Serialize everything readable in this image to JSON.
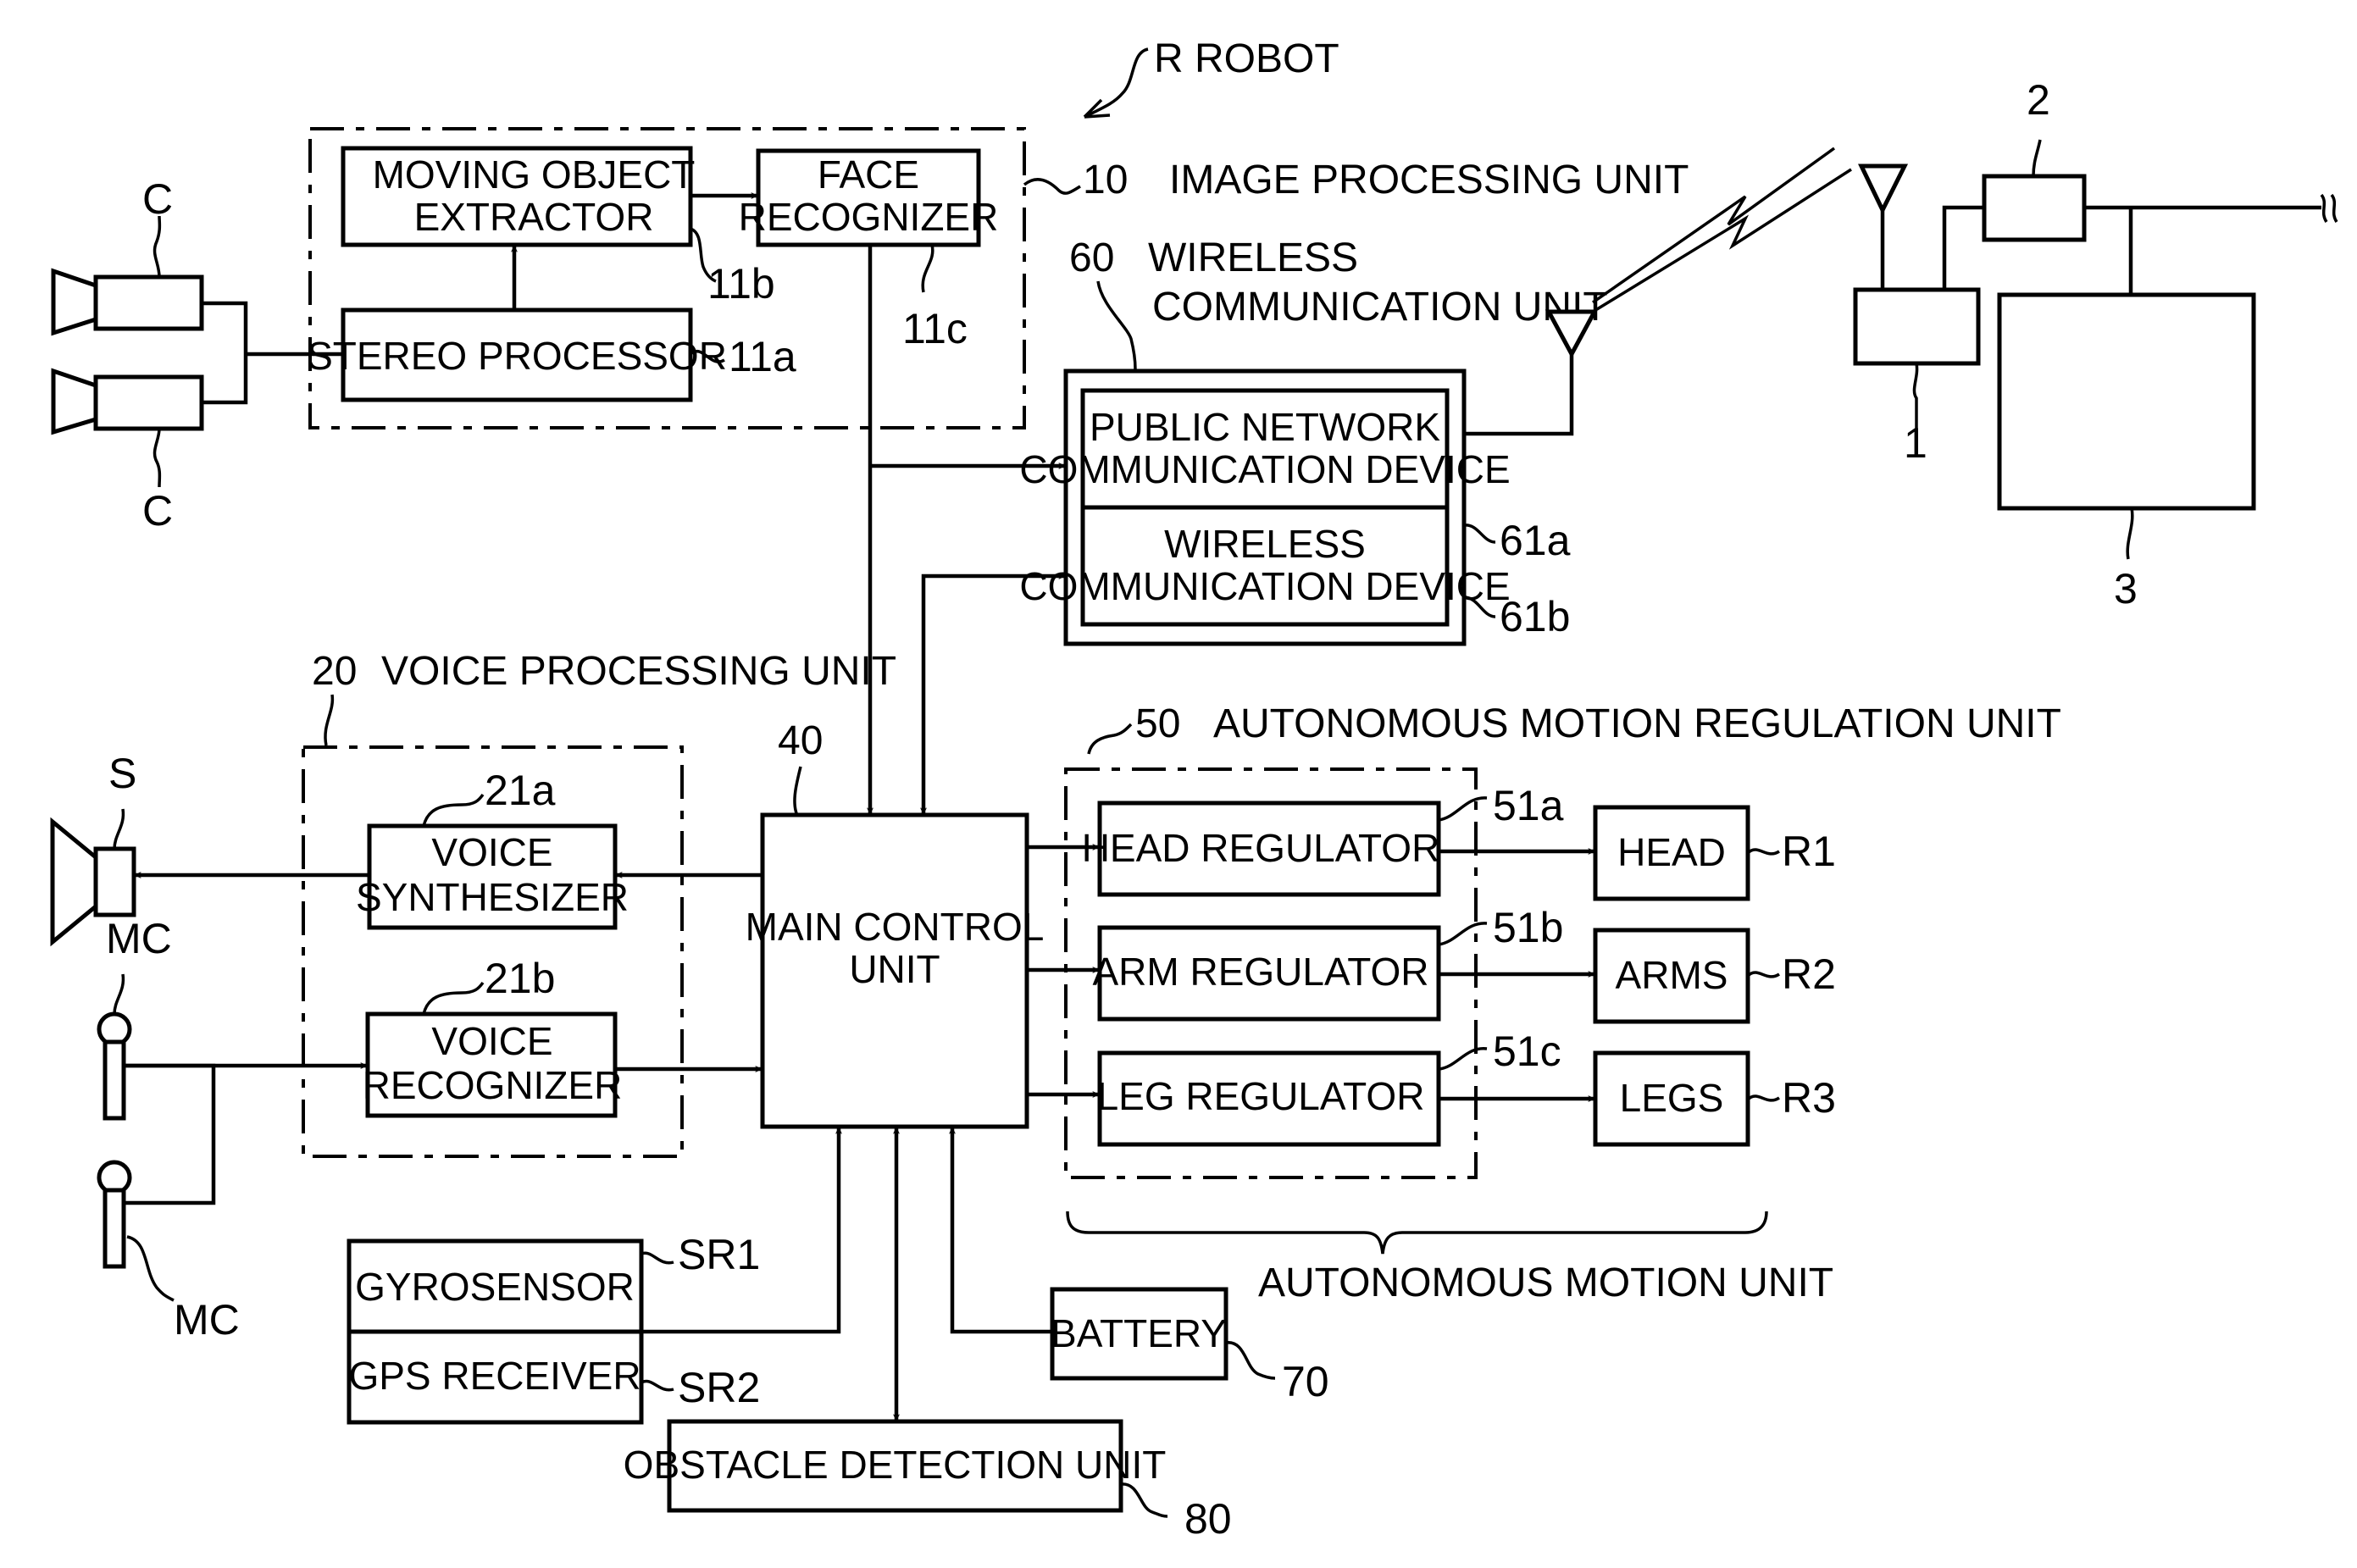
{
  "figure": {
    "robot_label": "R ROBOT",
    "units": {
      "image_processing": {
        "ref": "10",
        "title": "IMAGE PROCESSING UNIT"
      },
      "voice_processing": {
        "ref": "20",
        "title": "VOICE PROCESSING UNIT"
      },
      "main_control": {
        "ref": "40",
        "line1": "MAIN CONTROL",
        "line2": "UNIT"
      },
      "autonomous_regulation": {
        "ref": "50",
        "title": "AUTONOMOUS MOTION REGULATION UNIT"
      },
      "wireless": {
        "ref": "60",
        "title_line1": "WIRELESS",
        "title_line2": "COMMUNICATION UNIT"
      },
      "battery": {
        "ref": "70",
        "label": "BATTERY"
      },
      "obstacle": {
        "ref": "80",
        "label": "OBSTACLE DETECTION UNIT"
      },
      "autonomous_motion_unit": "AUTONOMOUS MOTION UNIT"
    },
    "blocks": {
      "stereo_processor": {
        "ref": "11a",
        "label": "STEREO PROCESSOR"
      },
      "moving_object_extractor": {
        "ref": "11b",
        "line1": "MOVING OBJECT",
        "line2": "EXTRACTOR"
      },
      "face_recognizer": {
        "ref": "11c",
        "line1": "FACE",
        "line2": "RECOGNIZER"
      },
      "voice_synthesizer": {
        "ref": "21a",
        "line1": "VOICE",
        "line2": "SYNTHESIZER"
      },
      "voice_recognizer": {
        "ref": "21b",
        "line1": "VOICE",
        "line2": "RECOGNIZER"
      },
      "head_regulator": {
        "ref": "51a",
        "label": "HEAD REGULATOR"
      },
      "arm_regulator": {
        "ref": "51b",
        "label": "ARM REGULATOR"
      },
      "leg_regulator": {
        "ref": "51c",
        "label": "LEG REGULATOR"
      },
      "public_network": {
        "ref": "61a",
        "line1": "PUBLIC NETWORK",
        "line2": "COMMUNICATION DEVICE"
      },
      "wireless_device": {
        "ref": "61b",
        "line1": "WIRELESS",
        "line2": "COMMUNICATION DEVICE"
      },
      "head": {
        "ref": "R1",
        "label": "HEAD"
      },
      "arms": {
        "ref": "R2",
        "label": "ARMS"
      },
      "legs": {
        "ref": "R3",
        "label": "LEGS"
      },
      "gyrosensor": {
        "ref": "SR1",
        "label": "GYROSENSOR"
      },
      "gps": {
        "ref": "SR2",
        "label": "GPS RECEIVER"
      }
    },
    "peripherals": {
      "camera_ref": "C",
      "speaker_ref": "S",
      "mic_ref": "MC"
    },
    "external": {
      "ref1": "1",
      "ref2": "2",
      "ref3": "3"
    }
  }
}
